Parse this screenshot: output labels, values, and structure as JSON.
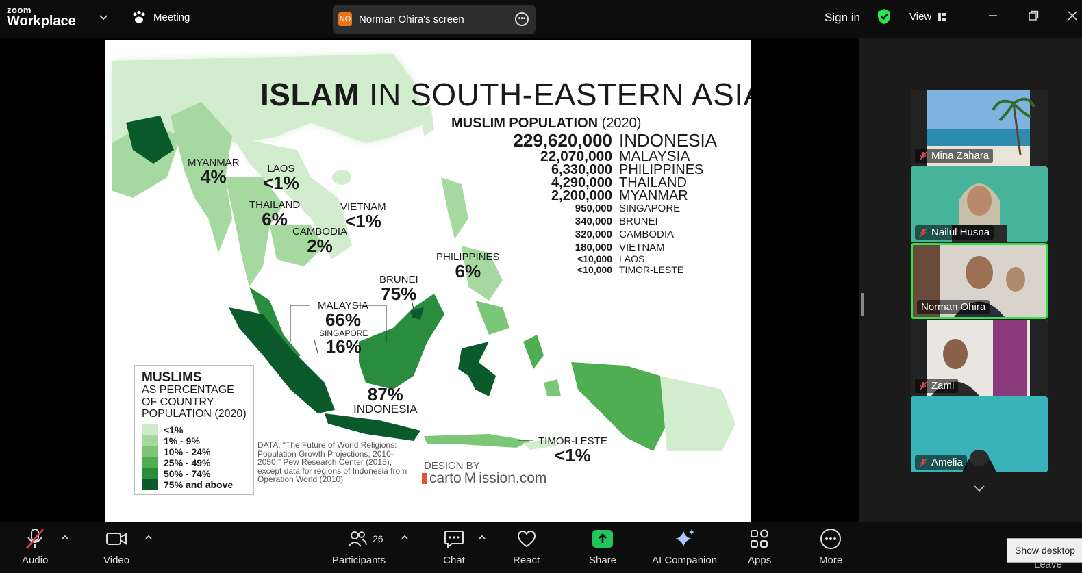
{
  "app": {
    "logo_top": "zoom",
    "logo_bottom": "Workplace",
    "meeting_label": "Meeting",
    "share_badge": "NO",
    "share_title": "Norman Ohira's screen",
    "sign_in": "Sign in",
    "view_label": "View",
    "accent_green": "#2ee44d"
  },
  "slide": {
    "title_bold": "ISLAM",
    "title_rest": " IN SOUTH-EASTERN ASIA",
    "population_title_bold": "MUSLIM POPULATION",
    "population_title_year": " (2020)",
    "population": [
      {
        "count": "229,620,000",
        "country": "INDONESIA"
      },
      {
        "count": "22,070,000",
        "country": "MALAYSIA"
      },
      {
        "count": "6,330,000",
        "country": "PHILIPPINES"
      },
      {
        "count": "4,290,000",
        "country": "THAILAND"
      },
      {
        "count": "2,200,000",
        "country": "MYANMAR"
      },
      {
        "count": "950,000",
        "country": "SINGAPORE"
      },
      {
        "count": "340,000",
        "country": "BRUNEI"
      },
      {
        "count": "320,000",
        "country": "CAMBODIA"
      },
      {
        "count": "180,000",
        "country": "VIETNAM"
      },
      {
        "count": "<10,000",
        "country": "LAOS"
      },
      {
        "count": "<10,000",
        "country": "TIMOR-LESTE"
      }
    ],
    "map_labels": [
      {
        "country": "MYANMAR",
        "pct": "4%"
      },
      {
        "country": "LAOS",
        "pct": "<1%"
      },
      {
        "country": "THAILAND",
        "pct": "6%"
      },
      {
        "country": "VIETNAM",
        "pct": "<1%"
      },
      {
        "country": "CAMBODIA",
        "pct": "2%"
      },
      {
        "country": "PHILIPPINES",
        "pct": "6%"
      },
      {
        "country": "BRUNEI",
        "pct": "75%"
      },
      {
        "country": "MALAYSIA",
        "pct": "66%"
      },
      {
        "country": "SINGAPORE",
        "pct": "16%"
      },
      {
        "country": "INDONESIA",
        "pct": "87%"
      },
      {
        "country": "TIMOR-LESTE",
        "pct": "<1%"
      }
    ],
    "legend": {
      "h1": "MUSLIMS",
      "h2a": "AS PERCENTAGE",
      "h2b": "OF COUNTRY",
      "h2c": "POPULATION (2020)",
      "rows": [
        {
          "label": "<1%",
          "color": "#cfeacb"
        },
        {
          "label": "1% - 9%",
          "color": "#a6d9a0"
        },
        {
          "label": "10% - 24%",
          "color": "#7cc777"
        },
        {
          "label": "25% - 49%",
          "color": "#4fae52"
        },
        {
          "label": "50% - 74%",
          "color": "#2a8d3e"
        },
        {
          "label": "75% and above",
          "color": "#0b5a2c"
        }
      ]
    },
    "source": "DATA: “The Future of World Religions: Population Growth Projections, 2010-2050,” Pew Research Center (2015), except data for regions of Indonesia from Operation World (2010)",
    "design_by": "DESIGN BY",
    "brand_a": "carto",
    "brand_b": "M",
    "brand_c": "ission.com"
  },
  "participants": [
    {
      "name": "Mina Zahara",
      "muted": true
    },
    {
      "name": "Nailul Husna",
      "muted": true
    },
    {
      "name": "Norman Ohira",
      "muted": false,
      "active": true
    },
    {
      "name": "Zami",
      "muted": true
    },
    {
      "name": "Amelia",
      "muted": true
    }
  ],
  "toolbar": {
    "audio": "Audio",
    "video": "Video",
    "participants": "Participants",
    "participants_count": "26",
    "chat": "Chat",
    "react": "React",
    "share": "Share",
    "ai": "AI Companion",
    "apps": "Apps",
    "more": "More",
    "leave": "Leave",
    "show_desktop": "Show desktop"
  }
}
